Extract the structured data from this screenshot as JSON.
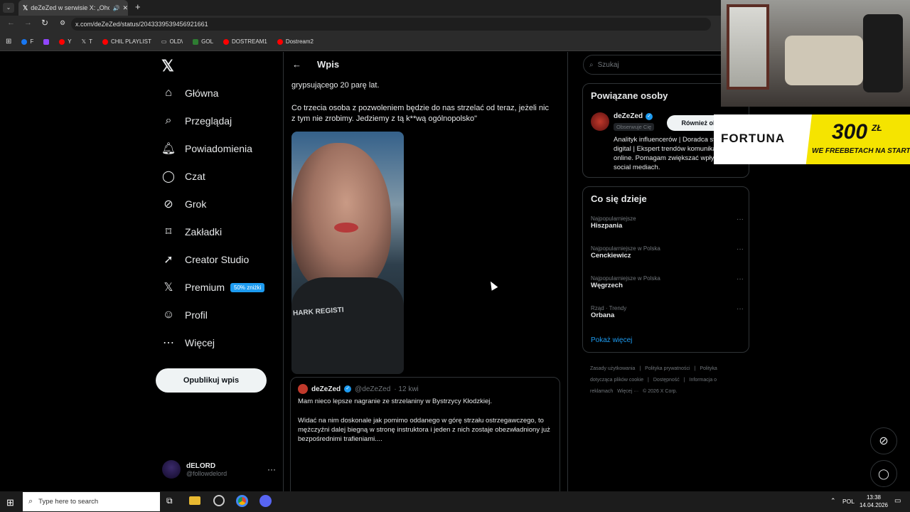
{
  "browser": {
    "tab_title": "deZeZed w serwisie X: „Oho",
    "url": "x.com/deZeZed/status/2043339539456921661",
    "bookmarks": [
      "F",
      "Y",
      "T",
      "CHIL PLAYLIST",
      "OLD\\",
      "GOL",
      "DOSTREAM1",
      "Dostream2"
    ]
  },
  "nav": {
    "items": [
      {
        "label": "Główna",
        "icon": "home-icon"
      },
      {
        "label": "Przeglądaj",
        "icon": "search-icon"
      },
      {
        "label": "Powiadomienia",
        "icon": "bell-icon"
      },
      {
        "label": "Czat",
        "icon": "chat-icon"
      },
      {
        "label": "Grok",
        "icon": "grok-icon"
      },
      {
        "label": "Zakładki",
        "icon": "bookmark-icon"
      },
      {
        "label": "Creator Studio",
        "icon": "rocket-icon"
      },
      {
        "label": "Premium",
        "icon": "x-icon"
      },
      {
        "label": "Profil",
        "icon": "person-icon"
      },
      {
        "label": "Więcej",
        "icon": "more-circle-icon"
      }
    ],
    "premium_badge": "50% zniżki",
    "publish_label": "Opublikuj wpis",
    "user_name": "dELORD",
    "user_handle": "@followdelord"
  },
  "post": {
    "header_title": "Wpis",
    "line1": "grypsującego 20 parę lat.",
    "line2": "Co trzecia osoba z pozwoleniem będzie do nas strzelać od teraz, jeżeli nic z tym nie zrobimy. Jedziemy z tą k**wą ogólnopolsko\"",
    "video_shirt_text": "HARK REGISTI"
  },
  "quote": {
    "name": "deZeZed",
    "handle": "@deZeZed",
    "time": "· 12 kwi",
    "line1": "Mam nieco lepsze nagranie ze strzelaniny w Bystrzycy Kłodzkiej.",
    "line2": "Widać na nim doskonale jak pomimo oddanego w górę strzału ostrzegawczego, to mężczyźni dalej biegną w stronę instruktora i jeden z nich zostaje obezwładniony już bezpośrednimi trafieniami...."
  },
  "right": {
    "search_placeholder": "Szukaj",
    "related_title": "Powiązane osoby",
    "person_name": "deZeZed",
    "person_follows": "Obserwuje Cię",
    "follow_back_label": "Również obs",
    "bio": "Analityk influencerów | Doradca strategii digital | Ekspert trendów komunikacji online. Pomagam zwiększać wpływ w social mediach.",
    "trends_title": "Co się dzieje",
    "trends": [
      {
        "cat": "Najpopularniejsze",
        "name": "Hiszpania"
      },
      {
        "cat": "Najpopularniejsze w Polska",
        "name": "Cenckiewicz"
      },
      {
        "cat": "Najpopularniejsze w Polska",
        "name": "Węgrzech"
      },
      {
        "cat": "Rząd · Trendy",
        "name": "Orbana"
      }
    ],
    "show_more": "Pokaż więcej",
    "footer": [
      "Zasady użytkowania",
      "|",
      "Polityka prywatności",
      "|",
      "Polityka dotycząca plików cookie",
      "|",
      "Dostępność",
      "|",
      "Informacja o reklamach",
      "Więcej ···",
      "© 2026 X Corp."
    ]
  },
  "overlay": {
    "brand": "FORTUNA",
    "amount": "300",
    "currency": "ZŁ",
    "tagline": "WE FREEBETACH NA START"
  },
  "taskbar": {
    "search_placeholder": "Type here to search",
    "lang": "POL",
    "time": "13:38",
    "date": "14.04.2026"
  },
  "colors": {
    "accent": "#1d9bf0",
    "fortuna_yellow": "#f5e400",
    "bg": "#000000"
  }
}
